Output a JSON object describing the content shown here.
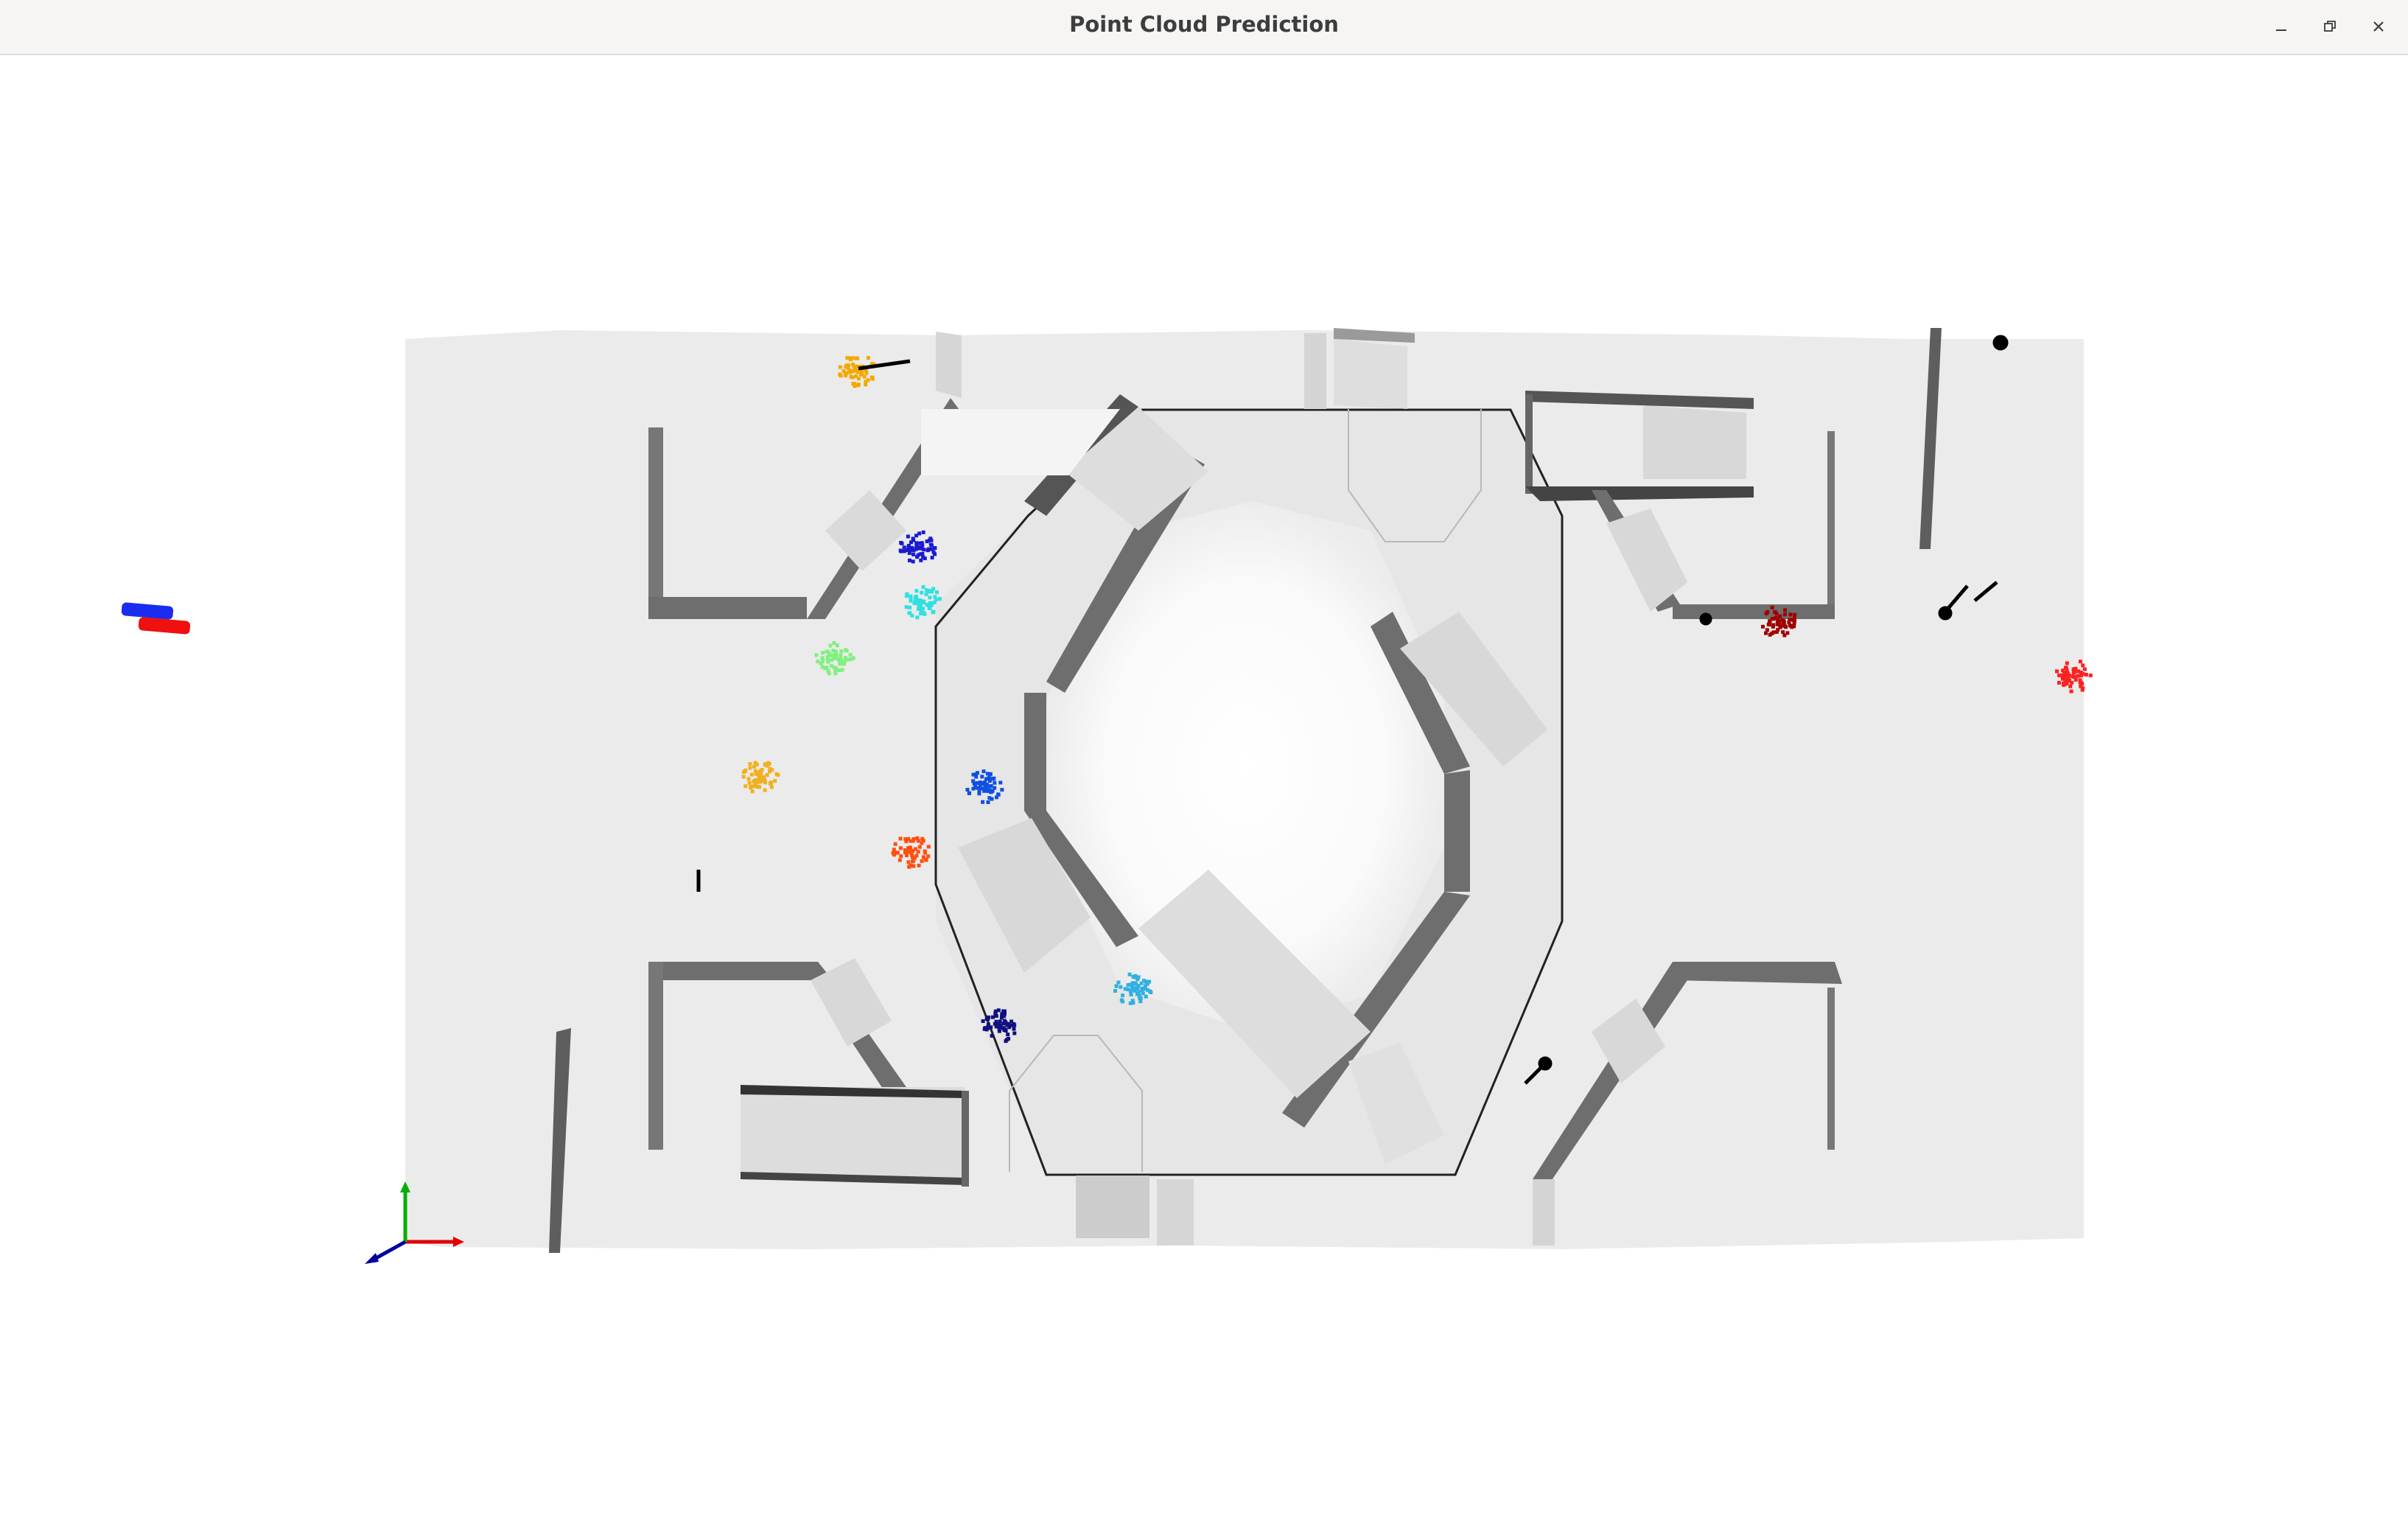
{
  "window": {
    "title": "Point Cloud Prediction",
    "controls": [
      {
        "name": "minimize-button",
        "icon": "minimize-icon"
      },
      {
        "name": "maximize-button",
        "icon": "maximize-icon"
      },
      {
        "name": "close-button",
        "icon": "close-icon"
      }
    ]
  },
  "scene": {
    "background": "#ffffff",
    "floor_color": "#ebebeb",
    "wall_color": "#6e6e6e",
    "wall_face_color": "#d9d9d9",
    "axes": {
      "x_color": "#e00000",
      "y_color": "#00b000",
      "z_color": "#0000a0"
    },
    "point_cloud_colors": [
      "#f5a800",
      "#1a1ad0",
      "#30e0e0",
      "#80f080",
      "#f0b020",
      "#1050e0",
      "#ff5010",
      "#30b0e0",
      "#101080",
      "#a00000",
      "#ff2020"
    ],
    "legend_markers": [
      "#1a2cf0",
      "#f01010"
    ]
  }
}
